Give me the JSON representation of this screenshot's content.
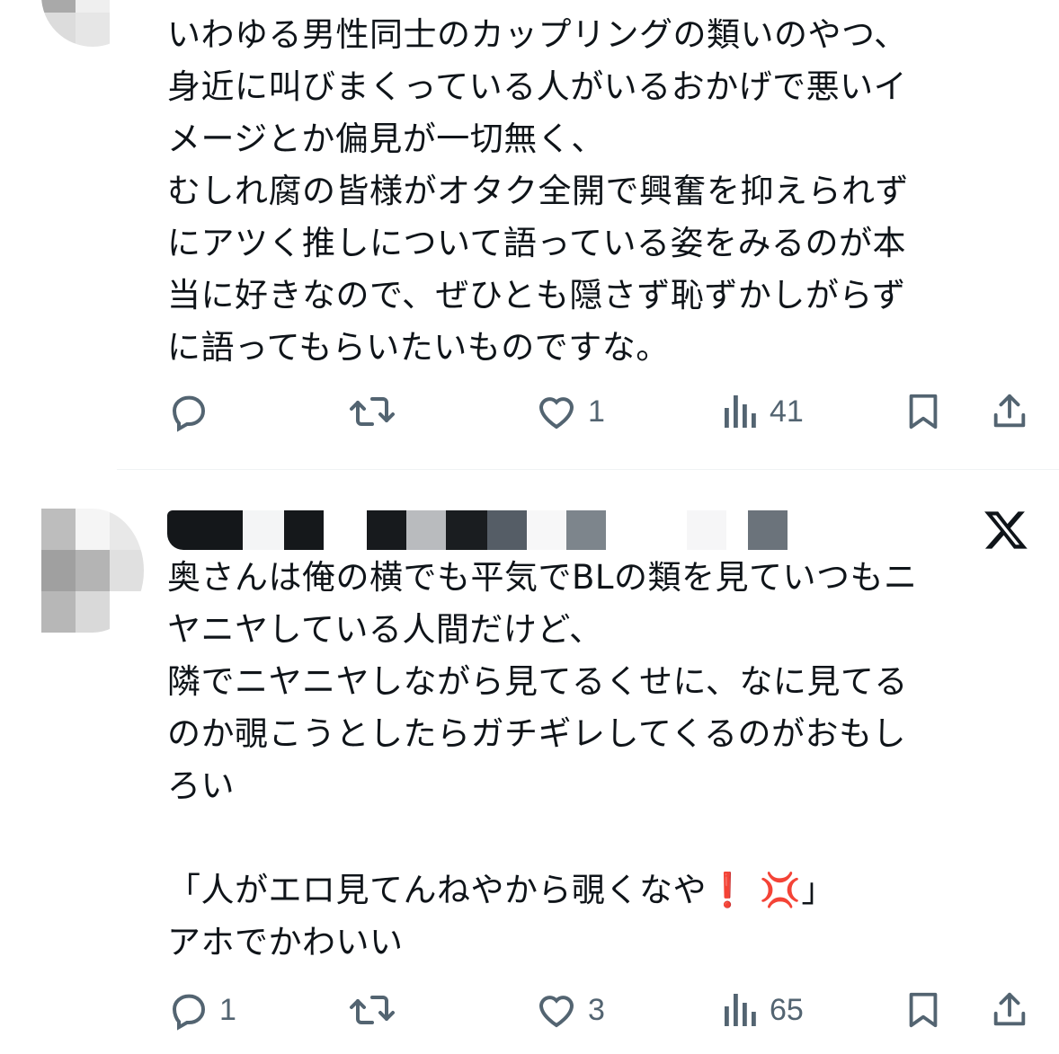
{
  "colors": {
    "text": "#0f1419",
    "muted": "#536471",
    "divider": "#eff3f4",
    "emoji_red": "#dd2e44"
  },
  "posts": [
    {
      "text": "いわゆる男性同士のカップリングの類いのやつ、\n身近に叫びまくっている人がいるおかげで悪いイ\nメージとか偏見が一切無く、\nむしれ腐の皆様がオタク全開で興奮を抑えられず\nにアツく推しについて語っている姿をみるのが本\n当に好きなので、ぜひとも隠さず恥ずかしがらず\nに語ってもらいたいものですな。",
      "metrics": {
        "replies": "",
        "reposts": "",
        "likes": "1",
        "views": "41"
      },
      "icons": [
        "reply-icon",
        "repost-icon",
        "like-icon",
        "views-icon",
        "bookmark-icon",
        "share-icon"
      ]
    },
    {
      "author_logo": "x-logo-icon",
      "text_main": "奥さんは俺の横でも平気でBLの類を見ていつもニ\nヤニヤしている人間だけど、\n隣でニヤニヤしながら見てるくせに、なに見てる\nのか覗こうとしたらガチギレしてくるのがおもし\nろい\n\n",
      "quote_open": "「人がエロ見てんねやから覗くなや",
      "emoji_bang": "❗",
      "emoji_anger": "💢",
      "quote_close": "」",
      "text_tail": "\nアホでかわいい",
      "metrics": {
        "replies": "1",
        "reposts": "",
        "likes": "3",
        "views": "65"
      },
      "icons": [
        "reply-icon",
        "repost-icon",
        "like-icon",
        "views-icon",
        "bookmark-icon",
        "share-icon"
      ]
    }
  ]
}
